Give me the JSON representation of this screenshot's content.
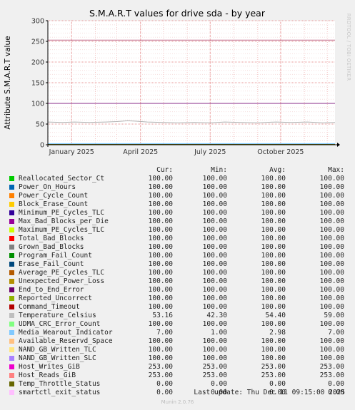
{
  "chart_data": {
    "type": "line",
    "title": "S.M.A.R.T values for drive sda - by year",
    "ylabel": "Attribute S.M.A.R.T value",
    "ylim": [
      0,
      300
    ],
    "yticks": [
      0,
      50,
      100,
      150,
      200,
      250,
      300
    ],
    "xlim": [
      "2024-12-01",
      "2025-12-11"
    ],
    "xticks": [
      {
        "label": "January 2025",
        "date": "2025-01-01"
      },
      {
        "label": "April 2025",
        "date": "2025-04-01"
      },
      {
        "label": "July 2025",
        "date": "2025-07-01"
      },
      {
        "label": "October 2025",
        "date": "2025-10-01"
      }
    ],
    "grid": true,
    "reference_lines": [
      {
        "value": 100,
        "color": "#8a2b8a"
      },
      {
        "value": 253,
        "color": "#c06a8a"
      }
    ],
    "temperature_series": {
      "name": "Temperature_Celsius",
      "color": "#b0b0b0",
      "points": [
        [
          "2024-12-01",
          55
        ],
        [
          "2024-12-20",
          54
        ],
        [
          "2025-01-05",
          55
        ],
        [
          "2025-01-25",
          54
        ],
        [
          "2025-02-15",
          55
        ],
        [
          "2025-03-01",
          56
        ],
        [
          "2025-03-15",
          58
        ],
        [
          "2025-03-25",
          57
        ],
        [
          "2025-04-10",
          55
        ],
        [
          "2025-05-01",
          54
        ],
        [
          "2025-05-20",
          53
        ],
        [
          "2025-06-10",
          54
        ],
        [
          "2025-07-01",
          53
        ],
        [
          "2025-07-20",
          55
        ],
        [
          "2025-08-10",
          54
        ],
        [
          "2025-09-01",
          53
        ],
        [
          "2025-09-25",
          55
        ],
        [
          "2025-10-15",
          54
        ],
        [
          "2025-11-05",
          55
        ],
        [
          "2025-11-25",
          53
        ],
        [
          "2025-12-11",
          54
        ]
      ]
    },
    "series": [
      {
        "name": "Reallocated_Sector_Ct",
        "color": "#00cc00",
        "cur": "100.00",
        "min": "100.00",
        "avg": "100.00",
        "max": "100.00"
      },
      {
        "name": "Power_On_Hours",
        "color": "#0066b3",
        "cur": "100.00",
        "min": "100.00",
        "avg": "100.00",
        "max": "100.00"
      },
      {
        "name": "Power_Cycle_Count",
        "color": "#ff8000",
        "cur": "100.00",
        "min": "100.00",
        "avg": "100.00",
        "max": "100.00"
      },
      {
        "name": "Block_Erase_Count",
        "color": "#ffcc00",
        "cur": "100.00",
        "min": "100.00",
        "avg": "100.00",
        "max": "100.00"
      },
      {
        "name": "Minimum_PE_Cycles_TLC",
        "color": "#330099",
        "cur": "100.00",
        "min": "100.00",
        "avg": "100.00",
        "max": "100.00"
      },
      {
        "name": "Max_Bad_Blocks_per_Die",
        "color": "#990099",
        "cur": "100.00",
        "min": "100.00",
        "avg": "100.00",
        "max": "100.00"
      },
      {
        "name": "Maximum_PE_Cycles_TLC",
        "color": "#ccff00",
        "cur": "100.00",
        "min": "100.00",
        "avg": "100.00",
        "max": "100.00"
      },
      {
        "name": "Total_Bad_Blocks",
        "color": "#ff0000",
        "cur": "100.00",
        "min": "100.00",
        "avg": "100.00",
        "max": "100.00"
      },
      {
        "name": "Grown_Bad_Blocks",
        "color": "#808080",
        "cur": "100.00",
        "min": "100.00",
        "avg": "100.00",
        "max": "100.00"
      },
      {
        "name": "Program_Fail_Count",
        "color": "#008f00",
        "cur": "100.00",
        "min": "100.00",
        "avg": "100.00",
        "max": "100.00"
      },
      {
        "name": "Erase_Fail_Count",
        "color": "#00487d",
        "cur": "100.00",
        "min": "100.00",
        "avg": "100.00",
        "max": "100.00"
      },
      {
        "name": "Average_PE_Cycles_TLC",
        "color": "#b35a00",
        "cur": "100.00",
        "min": "100.00",
        "avg": "100.00",
        "max": "100.00"
      },
      {
        "name": "Unexpected_Power_Loss",
        "color": "#b38f00",
        "cur": "100.00",
        "min": "100.00",
        "avg": "100.00",
        "max": "100.00"
      },
      {
        "name": "End_to_End_Error",
        "color": "#6b006b",
        "cur": "100.00",
        "min": "100.00",
        "avg": "100.00",
        "max": "100.00"
      },
      {
        "name": "Reported_Uncorrect",
        "color": "#8fb300",
        "cur": "100.00",
        "min": "100.00",
        "avg": "100.00",
        "max": "100.00"
      },
      {
        "name": "Command_Timeout",
        "color": "#b30000",
        "cur": "100.00",
        "min": "100.00",
        "avg": "100.00",
        "max": "100.00"
      },
      {
        "name": "Temperature_Celsius",
        "color": "#bebebe",
        "cur": "53.16",
        "min": "42.30",
        "avg": "54.40",
        "max": "59.00"
      },
      {
        "name": "UDMA_CRC_Error_Count",
        "color": "#80ff80",
        "cur": "100.00",
        "min": "100.00",
        "avg": "100.00",
        "max": "100.00"
      },
      {
        "name": "Media_Wearout_Indicator",
        "color": "#80c9ff",
        "cur": "7.00",
        "min": "1.00",
        "avg": "2.98",
        "max": "7.00"
      },
      {
        "name": "Available_Reservd_Space",
        "color": "#ffc080",
        "cur": "100.00",
        "min": "100.00",
        "avg": "100.00",
        "max": "100.00"
      },
      {
        "name": "NAND_GB_Written_TLC",
        "color": "#ffe680",
        "cur": "100.00",
        "min": "100.00",
        "avg": "100.00",
        "max": "100.00"
      },
      {
        "name": "NAND_GB_Written_SLC",
        "color": "#aa80ff",
        "cur": "100.00",
        "min": "100.00",
        "avg": "100.00",
        "max": "100.00"
      },
      {
        "name": "Host_Writes_GiB",
        "color": "#ee00cc",
        "cur": "253.00",
        "min": "253.00",
        "avg": "253.00",
        "max": "253.00"
      },
      {
        "name": "Host_Reads_GiB",
        "color": "#ff8080",
        "cur": "253.00",
        "min": "253.00",
        "avg": "253.00",
        "max": "253.00"
      },
      {
        "name": "Temp_Throttle_Status",
        "color": "#666600",
        "cur": "0.00",
        "min": "0.00",
        "avg": "0.00",
        "max": "0.00"
      },
      {
        "name": "smartctl_exit_status",
        "color": "#ffbfff",
        "cur": "0.00",
        "min": "0.00",
        "avg": "0.00",
        "max": "0.00"
      }
    ]
  },
  "side_text": "RRDTOOL / TOBI OETIKER",
  "legend_headers": {
    "cur": "Cur:",
    "min": "Min:",
    "avg": "Avg:",
    "max": "Max:"
  },
  "last_update": "Last update: Thu Dec 11 09:15:00 2025",
  "footer": "Munin 2.0.76"
}
